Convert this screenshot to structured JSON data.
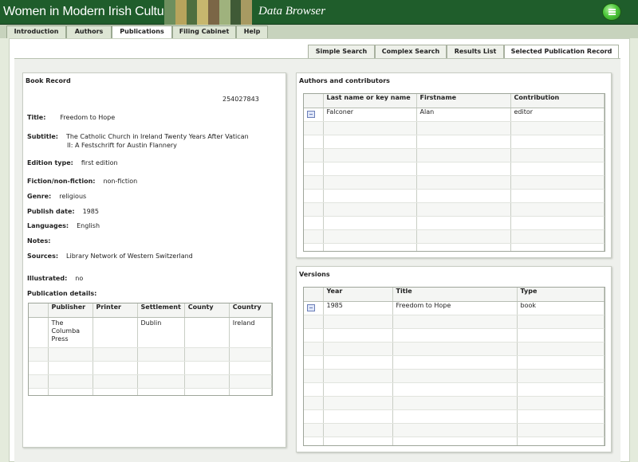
{
  "header": {
    "app_title": "Women in Modern Irish Culture",
    "subtitle": "Data Browser",
    "book_colors": [
      "#6e8f5e",
      "#b8a45c",
      "#4f6f3f",
      "#c7b76e",
      "#7b6646",
      "#9fb27d",
      "#3f5a36",
      "#a89a62"
    ]
  },
  "main_tabs": [
    {
      "label": "Introduction"
    },
    {
      "label": "Authors"
    },
    {
      "label": "Publications"
    },
    {
      "label": "Filing Cabinet"
    },
    {
      "label": "Help"
    }
  ],
  "sub_tabs": [
    {
      "label": "Simple Search"
    },
    {
      "label": "Complex Search"
    },
    {
      "label": "Results List"
    },
    {
      "label": "Selected Publication Record"
    }
  ],
  "book_record": {
    "title_label": "Book Record",
    "record_id": "254027843",
    "fields": {
      "title": {
        "label": "Title:",
        "value": "Freedom to Hope"
      },
      "subtitle": {
        "label": "Subtitle:",
        "value_line1": "The Catholic Church in Ireland Twenty Years After Vatican",
        "value_line2": "II: A Festschrift for Austin Flannery"
      },
      "edition_type": {
        "label": "Edition type:",
        "value": "first edition"
      },
      "fiction": {
        "label": "Fiction/non-fiction:",
        "value": "non-fiction"
      },
      "genre": {
        "label": "Genre:",
        "value": "religious"
      },
      "publish_date": {
        "label": "Publish date:",
        "value": "1985"
      },
      "languages": {
        "label": "Languages:",
        "value": "English"
      },
      "notes": {
        "label": "Notes:",
        "value": ""
      },
      "sources": {
        "label": "Sources:",
        "value": "Library Network of Western Switzerland"
      },
      "illustrated": {
        "label": "Illustrated:",
        "value": "no"
      }
    },
    "pub_details_label": "Publication details:",
    "pub_table": {
      "headers": [
        "Publisher",
        "Printer",
        "Settlement",
        "County",
        "Country"
      ],
      "rows": [
        {
          "publisher_l1": "The",
          "publisher_l2": "Columba",
          "publisher_l3": "Press",
          "printer": "",
          "settlement": "Dublin",
          "county": "",
          "country": "Ireland"
        }
      ]
    }
  },
  "authors_panel": {
    "title": "Authors and contributors",
    "headers": [
      "Last name or key name",
      "Firstname",
      "Contribution"
    ],
    "rows": [
      {
        "last": "Falconer",
        "first": "Alan",
        "contribution": "editor"
      }
    ]
  },
  "versions_panel": {
    "title": "Versions",
    "headers": [
      "Year",
      "Title",
      "Type"
    ],
    "rows": [
      {
        "year": "1985",
        "title": "Freedom to Hope",
        "type": "book"
      }
    ]
  }
}
